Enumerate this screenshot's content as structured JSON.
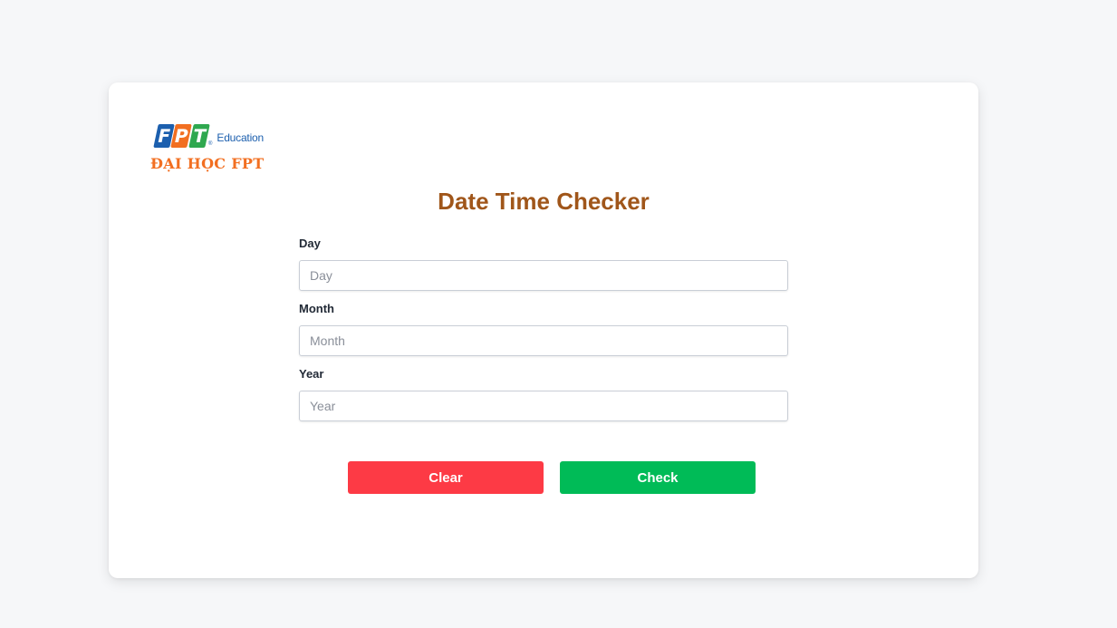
{
  "brand": {
    "logo_letters": [
      "F",
      "P",
      "T"
    ],
    "logo_registered": "®",
    "logo_suffix": "Education",
    "university_name": "ĐẠI HỌC FPT",
    "colors": {
      "blue": "#1c5fae",
      "orange": "#f26f21",
      "green": "#2fa84f"
    }
  },
  "form": {
    "title": "Date Time Checker",
    "fields": [
      {
        "label": "Day",
        "placeholder": "Day",
        "value": ""
      },
      {
        "label": "Month",
        "placeholder": "Month",
        "value": ""
      },
      {
        "label": "Year",
        "placeholder": "Year",
        "value": ""
      }
    ]
  },
  "actions": {
    "clear_label": "Clear",
    "check_label": "Check",
    "clear_color": "#fd3a45",
    "check_color": "#00bb57"
  },
  "theme": {
    "title_color": "#a0561a",
    "background": "#f6f7f9"
  }
}
